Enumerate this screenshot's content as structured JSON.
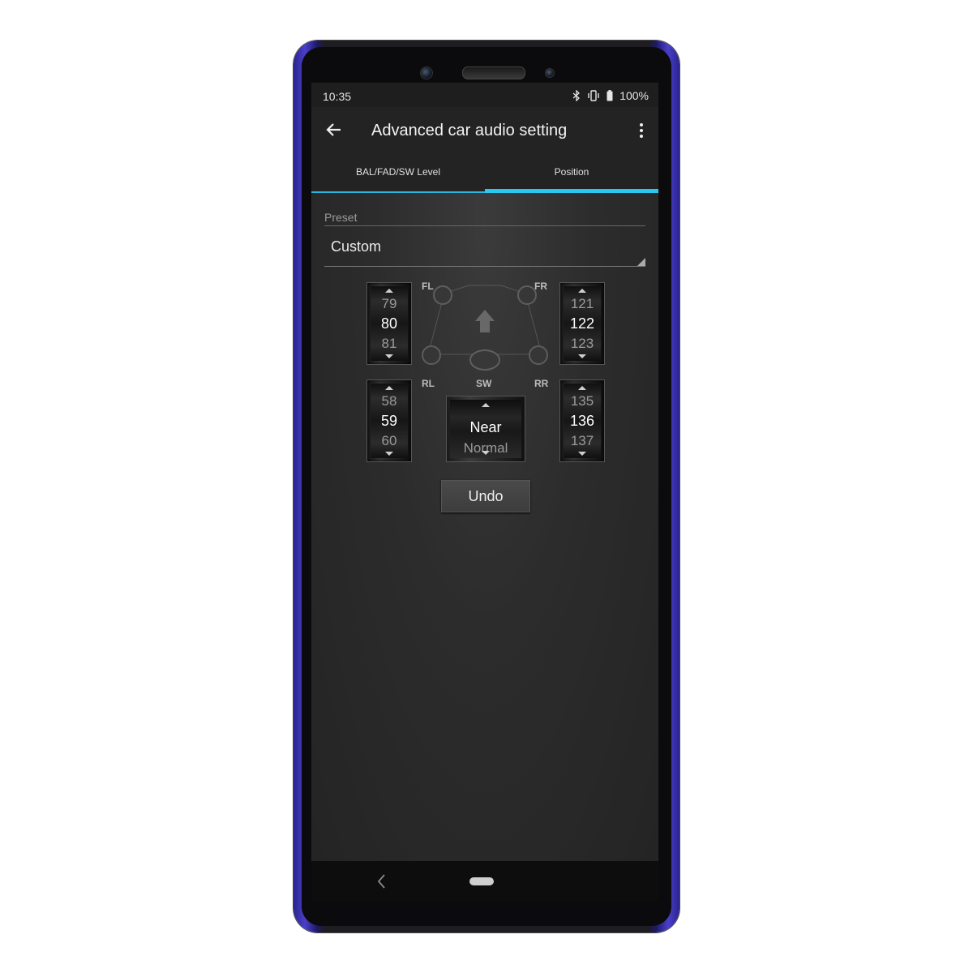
{
  "status": {
    "time": "10:35",
    "battery": "100%",
    "icons": [
      "bluetooth-icon",
      "vibrate-icon",
      "battery-icon"
    ]
  },
  "appbar": {
    "title": "Advanced car audio setting",
    "back_icon": "arrow-left-icon",
    "menu_icon": "more-vert-icon"
  },
  "tabs": [
    {
      "label": "BAL/FAD/SW Level",
      "active": false
    },
    {
      "label": "Position",
      "active": true
    }
  ],
  "colors": {
    "accent": "#29c8ef",
    "frame": "#3d33b8"
  },
  "preset": {
    "label": "Preset",
    "value": "Custom"
  },
  "speakers": {
    "fl": {
      "label": "FL",
      "prev": "79",
      "current": "80",
      "next": "81"
    },
    "fr": {
      "label": "FR",
      "prev": "121",
      "current": "122",
      "next": "123"
    },
    "rl": {
      "label": "RL",
      "prev": "58",
      "current": "59",
      "next": "60"
    },
    "rr": {
      "label": "RR",
      "prev": "135",
      "current": "136",
      "next": "137"
    },
    "sw": {
      "label": "SW",
      "current": "Near",
      "next": "Normal"
    }
  },
  "actions": {
    "undo": "Undo"
  },
  "navbar": {
    "icons": [
      "nav-back-icon",
      "home-pill-icon"
    ]
  }
}
